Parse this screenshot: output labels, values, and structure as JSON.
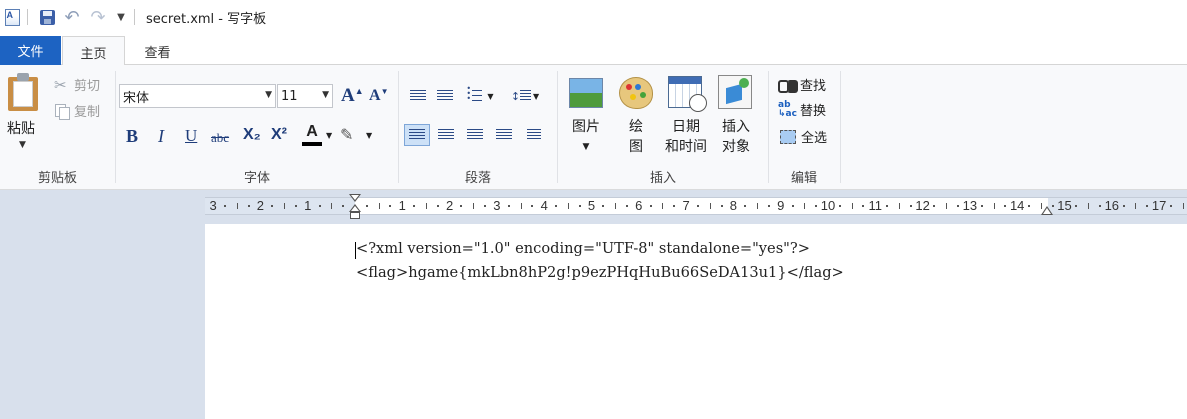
{
  "window": {
    "title": "secret.xml - 写字板"
  },
  "tabs": {
    "file": "文件",
    "home": "主页",
    "view": "查看"
  },
  "clipboard": {
    "paste": "粘贴",
    "cut": "剪切",
    "copy": "复制",
    "group_label": "剪贴板"
  },
  "font": {
    "name": "宋体",
    "size": "11",
    "group_label": "字体",
    "grow": "A",
    "shrink": "A",
    "bold": "B",
    "italic": "I",
    "underline": "U",
    "strike": "abc",
    "subscript": "X₂",
    "superscript": "X²",
    "color_a": "A"
  },
  "paragraph": {
    "group_label": "段落"
  },
  "insert": {
    "picture": "图片",
    "paint_line1": "绘",
    "paint_line2": "图",
    "datetime_line1": "日期",
    "datetime_line2": "和时间",
    "object_line1": "插入",
    "object_line2": "对象",
    "group_label": "插入"
  },
  "edit": {
    "find": "查找",
    "replace": "替换",
    "select_all": "全选",
    "group_label": "编辑"
  },
  "ruler": {
    "labels": [
      "3",
      "2",
      "1",
      "1",
      "2",
      "3",
      "4",
      "5",
      "6",
      "7",
      "8",
      "9",
      "10",
      "11",
      "12",
      "13",
      "14",
      "15",
      "16",
      "17"
    ]
  },
  "document": {
    "lines": [
      "<?xml version=\"1.0\" encoding=\"UTF-8\" standalone=\"yes\"?>",
      "<flag>hgame{mkLbn8hP2g!p9ezPHqHuBu66SeDA13u1}</flag>"
    ]
  },
  "colors": {
    "file_tab": "#1d63c2",
    "ribbon_bg": "#f8f9fb",
    "workspace_bg": "#d8e0ec",
    "font_color_bar": "#000000"
  }
}
